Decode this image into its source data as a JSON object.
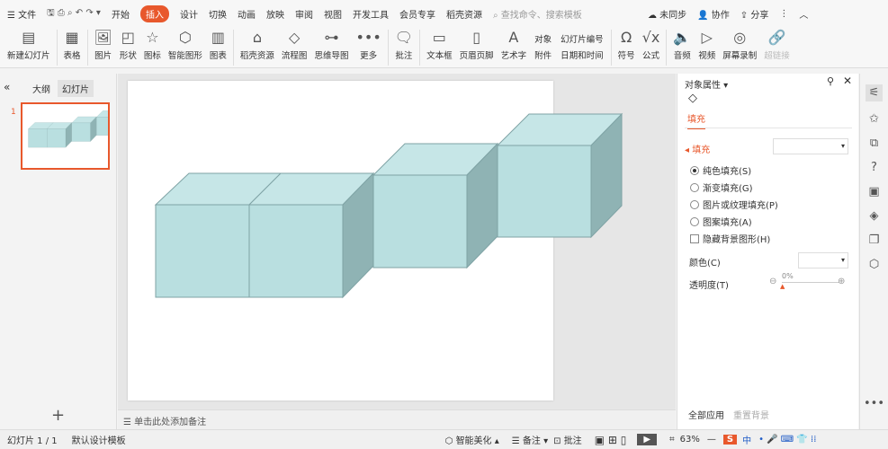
{
  "menu": {
    "file": "文件",
    "tabs": [
      "开始",
      "插入",
      "设计",
      "切换",
      "动画",
      "放映",
      "审阅",
      "视图",
      "开发工具",
      "会员专享",
      "稻壳资源"
    ],
    "active_tab": "插入",
    "search_placeholder": "查找命令、搜索模板",
    "sync": "未同步",
    "collab": "协作",
    "share": "分享"
  },
  "ribbon": {
    "items": [
      "新建幻灯片",
      "表格",
      "图片",
      "形状",
      "图标",
      "智能图形",
      "图表",
      "稻壳资源",
      "流程图",
      "思维导图",
      "更多",
      "批注",
      "文本框",
      "页眉页脚",
      "艺术字"
    ],
    "pair1": [
      "对象",
      "附件"
    ],
    "pair2": [
      "幻灯片编号",
      "日期和时间"
    ],
    "items2": [
      "符号",
      "公式",
      "音频",
      "视频",
      "屏幕录制",
      "超链接"
    ]
  },
  "left": {
    "tabs": [
      "大纲",
      "幻灯片"
    ],
    "slide_number": "1",
    "add": "+"
  },
  "notes": {
    "placeholder": "单击此处添加备注"
  },
  "panel": {
    "title": "对象属性",
    "tab": "填充",
    "section": "填充",
    "options": [
      "纯色填充(S)",
      "渐变填充(G)",
      "图片或纹理填充(P)",
      "图案填充(A)"
    ],
    "selected": 0,
    "hide_bg": "隐藏背景图形(H)",
    "color_label": "颜色(C)",
    "transparency_label": "透明度(T)",
    "transparency": "0%",
    "apply_all": "全部应用",
    "reset_bg": "重置背景"
  },
  "status": {
    "slide": "幻灯片 1 / 1",
    "template": "默认设计模板",
    "beautify": "智能美化",
    "notes": "备注",
    "comment": "批注",
    "zoom": "63%",
    "ime": "中"
  },
  "colors": {
    "accent": "#e8582c",
    "cube_front": "#b9dfe0",
    "cube_top": "#c6e6e7",
    "cube_side": "#8fb3b4"
  }
}
